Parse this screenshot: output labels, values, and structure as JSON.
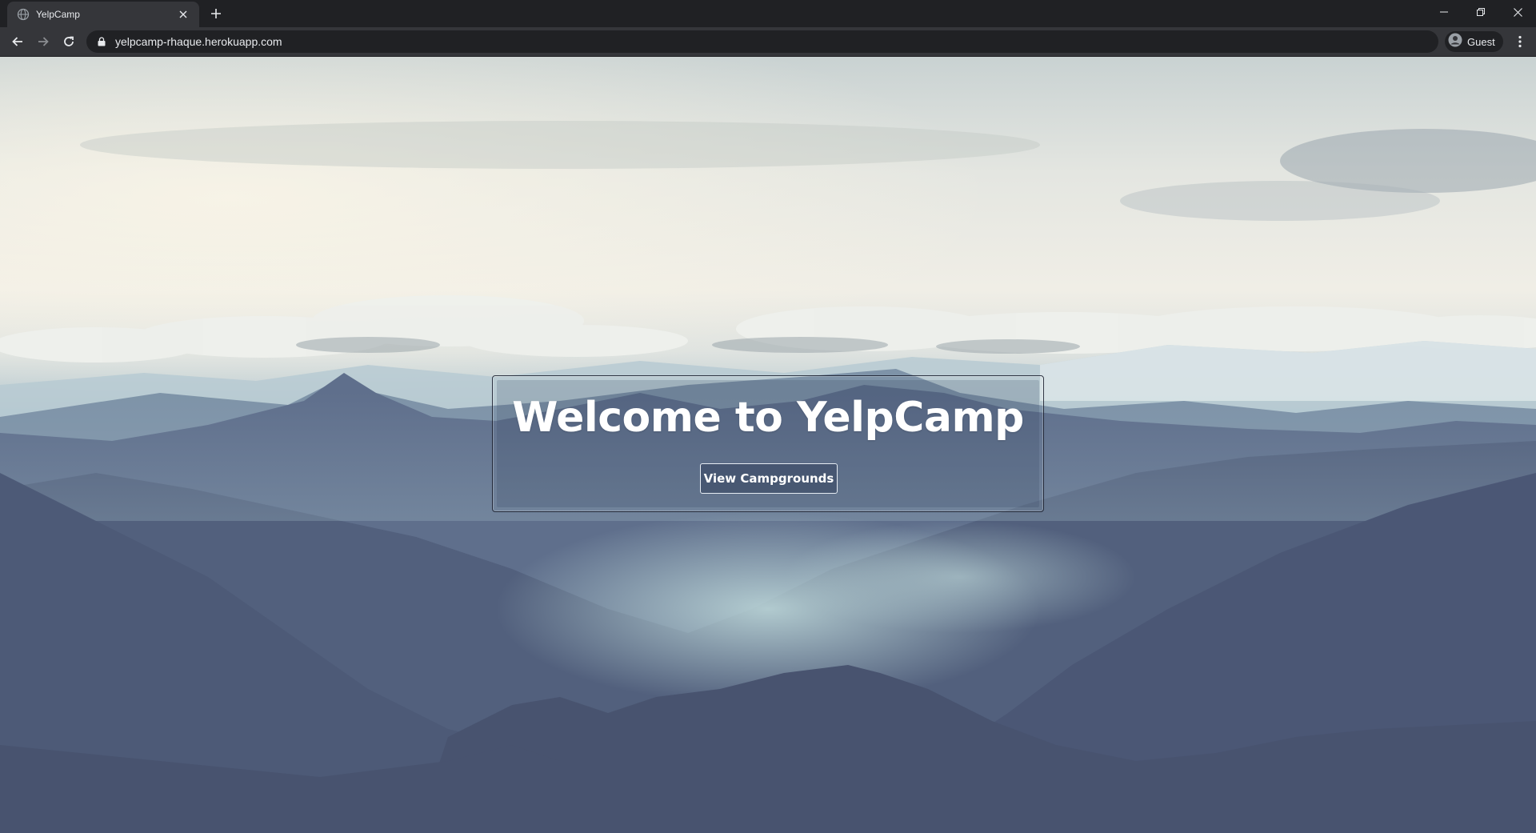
{
  "browser": {
    "tab": {
      "title": "YelpCamp"
    },
    "address_bar": {
      "url": "yelpcamp-rhaque.herokuapp.com"
    },
    "profile": {
      "label": "Guest"
    }
  },
  "icons": {
    "favicon": "globe-icon",
    "tab_close": "close-icon",
    "new_tab": "plus-icon",
    "back": "back-arrow-icon",
    "forward": "forward-arrow-icon",
    "reload": "reload-icon",
    "lock": "lock-icon",
    "profile": "account-circle-icon",
    "menu": "kebab-menu-icon",
    "minimize": "minimize-icon",
    "restore": "restore-icon",
    "close_window": "close-icon"
  },
  "hero": {
    "title": "Welcome to YelpCamp",
    "button_label": "View Campgrounds"
  },
  "colors": {
    "browser_frame": "#202124",
    "toolbar": "#35363a",
    "mountain_dark": "#4a5572",
    "mountain_mid": "#5c718e",
    "sky_light": "#f0eee6"
  }
}
